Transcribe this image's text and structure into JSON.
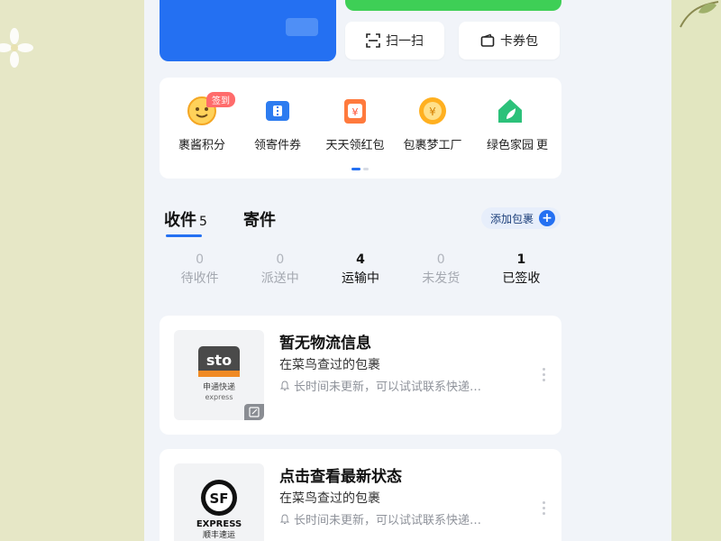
{
  "quick_actions": {
    "scan_label": "扫一扫",
    "coupon_label": "卡券包"
  },
  "services": [
    {
      "label": "裹酱积分",
      "icon": "smile-icon",
      "badge": "签到"
    },
    {
      "label": "领寄件券",
      "icon": "ticket-icon"
    },
    {
      "label": "天天领红包",
      "icon": "red-envelope-icon"
    },
    {
      "label": "包裹梦工厂",
      "icon": "coin-icon"
    },
    {
      "label": "绿色家园",
      "icon": "green-home-icon"
    },
    {
      "label": "更",
      "icon": "more-icon"
    }
  ],
  "tabs": {
    "receive": "收件",
    "receive_count": "5",
    "send": "寄件",
    "add_package": "添加包裹"
  },
  "statuses": [
    {
      "count": "0",
      "label": "待收件"
    },
    {
      "count": "0",
      "label": "派送中"
    },
    {
      "count": "4",
      "label": "运输中"
    },
    {
      "count": "0",
      "label": "未发货"
    },
    {
      "count": "1",
      "label": "已签收"
    }
  ],
  "packages": [
    {
      "title": "暂无物流信息",
      "subtitle": "在菜鸟查过的包裹",
      "note": "长时间未更新，可以试试联系快递…",
      "carrier_logo": "sto",
      "carrier_name": "申通快递",
      "carrier_en": "express"
    },
    {
      "title": "点击查看最新状态",
      "subtitle": "在菜鸟查过的包裹",
      "note": "长时间未更新，可以试试联系快递…",
      "carrier_logo": "SF",
      "carrier_name": "顺丰速运",
      "carrier_en": "EXPRESS"
    }
  ],
  "colors": {
    "accent": "#2470f2",
    "green": "#3ecf56",
    "badge": "#ff6b6b"
  }
}
